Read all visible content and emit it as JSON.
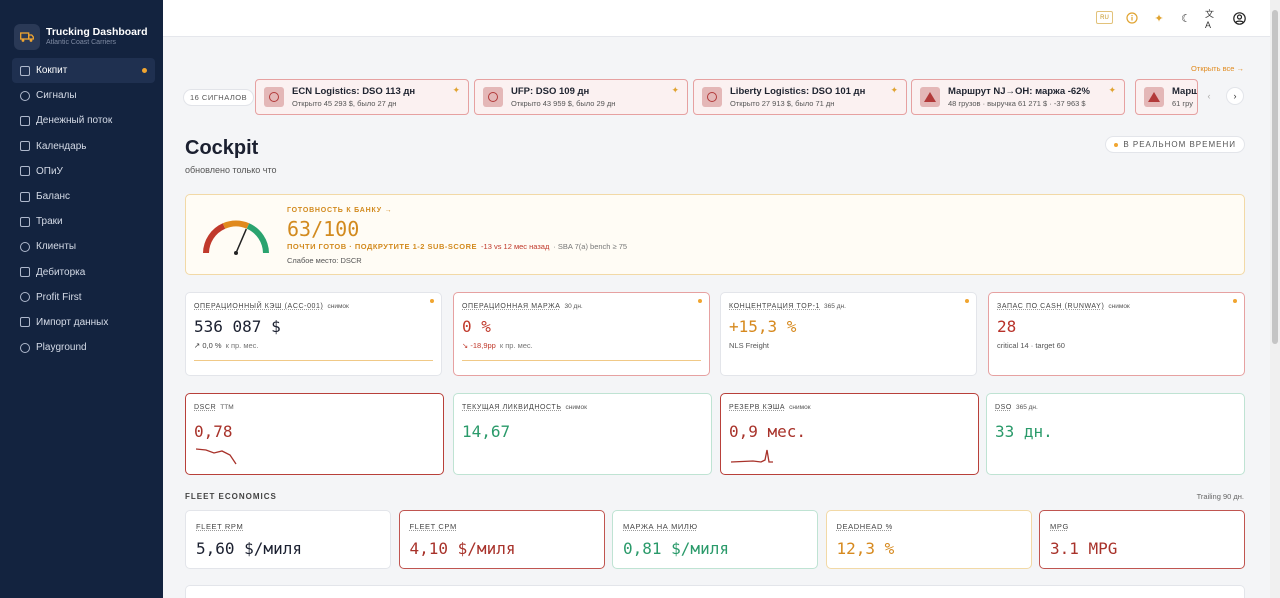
{
  "brand": {
    "title": "Trucking Dashboard",
    "subtitle": "Atlantic Coast Carriers",
    "icon": "truck-icon"
  },
  "sidebar": {
    "items": [
      {
        "label": "Кокпит",
        "icon": "cockpit-icon",
        "active": true
      },
      {
        "label": "Сигналы",
        "icon": "bell-icon"
      },
      {
        "label": "Денежный поток",
        "icon": "activity-icon"
      },
      {
        "label": "Календарь",
        "icon": "calendar-icon"
      },
      {
        "label": "ОПиУ",
        "icon": "document-icon"
      },
      {
        "label": "Баланс",
        "icon": "scale-icon"
      },
      {
        "label": "Траки",
        "icon": "truck-icon"
      },
      {
        "label": "Клиенты",
        "icon": "users-icon"
      },
      {
        "label": "Дебиторка",
        "icon": "receivables-icon"
      },
      {
        "label": "Profit First",
        "icon": "target-icon"
      },
      {
        "label": "Импорт данных",
        "icon": "upload-icon"
      },
      {
        "label": "Playground",
        "icon": "palette-icon"
      }
    ]
  },
  "topbar": {
    "badge": "RU",
    "icons": [
      "info-icon",
      "sparkle-icon",
      "moon-icon",
      "translate-icon",
      "user-icon"
    ]
  },
  "signals": {
    "count_label": "16 СИГНАЛОВ",
    "open_all": "Открыть все →",
    "alerts": [
      {
        "title": "ECN Logistics: DSO 113 дн",
        "sub": "Открыто 45 293 $, было 27 дн",
        "icon": "clock-icon"
      },
      {
        "title": "UFP: DSO 109 дн",
        "sub": "Открыто 43 959 $, было 29 дн",
        "icon": "clock-icon"
      },
      {
        "title": "Liberty Logistics: DSO 101 дн",
        "sub": "Открыто 27 913 $, было 71 дн",
        "icon": "clock-icon"
      },
      {
        "title": "Маршрут NJ→OH: маржа -62%",
        "sub": "48 грузов · выручка 61 271 $ · -37 963 $",
        "icon": "warning-icon"
      },
      {
        "title": "Марш",
        "sub": "61 гру",
        "icon": "warning-icon"
      }
    ]
  },
  "page": {
    "title": "Cockpit",
    "subtitle": "обновлено только что",
    "realtime": "В РЕАЛЬНОМ ВРЕМЕНИ"
  },
  "bank": {
    "label": "ГОТОВНОСТЬ К БАНКУ",
    "arrow": "→",
    "score": "63/100",
    "score_value": 63,
    "status": "ПОЧТИ ГОТОВ · ПОДКРУТИТЕ 1-2 SUB-SCORE",
    "delta": "-13 vs 12 мес назад",
    "bench": "· SBA 7(a) bench ≥ 75",
    "weak": "Слабое место: DSCR"
  },
  "kpis_row1": [
    {
      "label": "ОПЕРАЦИОННЫЙ КЭШ (ACC-001)",
      "tag": "снимок",
      "value": "536 087 $",
      "trend_icon": "↗",
      "trend": "0,0 %",
      "trend_note": "к пр. мес.",
      "value_color": "#1b2030",
      "trend_color": "#444",
      "border": "#e3e5ea",
      "dot": true,
      "line": true
    },
    {
      "label": "ОПЕРАЦИОННАЯ МАРЖА",
      "tag": "30 дн.",
      "value": "0 %",
      "trend_icon": "↘",
      "trend": "-18,9pp",
      "trend_note": "к пр. мес.",
      "value_color": "#c0392b",
      "trend_color": "#c0392b",
      "border": "#e6a1a1",
      "dot": true,
      "line": true
    },
    {
      "label": "КОНЦЕНТРАЦИЯ TOP-1",
      "tag": "365 дн.",
      "value": "+15,3 %",
      "foot": "NLS Freight",
      "value_color": "#d6891e",
      "border": "#e3e5ea",
      "dot": true
    },
    {
      "label": "ЗАПАС ПО CASH (RUNWAY)",
      "tag": "снимок",
      "value": "28",
      "foot": "critical 14 · target 60",
      "value_color": "#b8322a",
      "border": "#e6a1a1",
      "dot": true
    }
  ],
  "kpis_row2": [
    {
      "label": "DSCR",
      "tag": "TTM",
      "value": "0,78",
      "value_color": "#a8322a",
      "border": "#b8403a",
      "spark": "down"
    },
    {
      "label": "ТЕКУЩАЯ ЛИКВИДНОСТЬ",
      "tag": "снимок",
      "value": "14,67",
      "value_color": "#2a9a6a",
      "border": "#bfe3d3"
    },
    {
      "label": "РЕЗЕРВ КЭША",
      "tag": "снимок",
      "value": "0,9 мес.",
      "value_color": "#a8322a",
      "border": "#b8403a",
      "spark": "spike"
    },
    {
      "label": "DSO",
      "tag": "365 дн.",
      "value": "33 дн.",
      "value_color": "#2a9a6a",
      "border": "#bfe3d3"
    }
  ],
  "fleet": {
    "title": "FLEET ECONOMICS",
    "trailing": "Trailing 90 дн.",
    "cards": [
      {
        "label": "FLEET RPM",
        "value": "5,60 $/миля",
        "value_color": "#1b2030",
        "border": "#e3e5ea"
      },
      {
        "label": "FLEET CPM",
        "value": "4,10 $/миля",
        "value_color": "#a8322a",
        "border": "#c05550"
      },
      {
        "label": "МАРЖА НА МИЛЮ",
        "value": "0,81 $/миля",
        "value_color": "#2a9a6a",
        "border": "#bfe3d3"
      },
      {
        "label": "DEADHEAD %",
        "value": "12,3 %",
        "value_color": "#d6891e",
        "border": "#f2d9a6"
      },
      {
        "label": "MPG",
        "value": "3.1 MPG",
        "value_color": "#a8322a",
        "border": "#c05550"
      }
    ]
  }
}
